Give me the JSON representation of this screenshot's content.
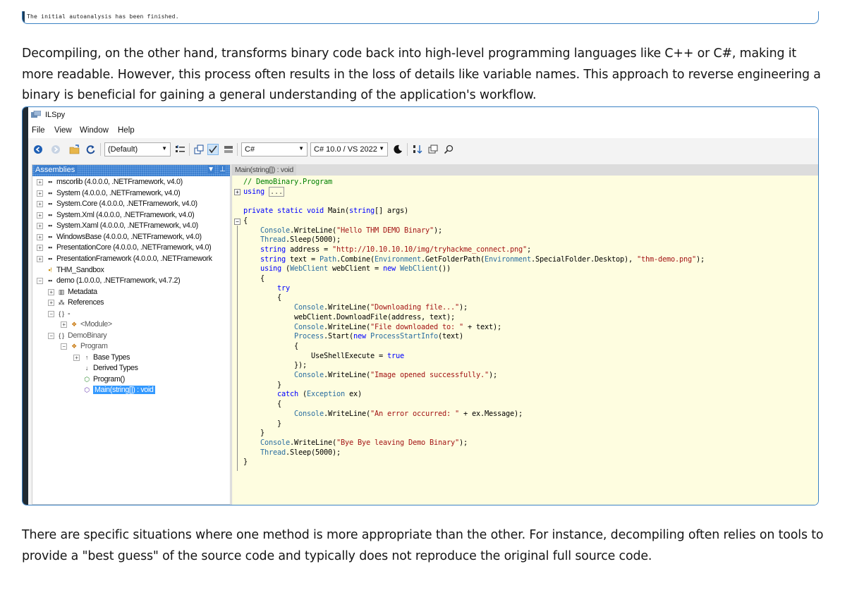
{
  "top_strip": {
    "text": "The initial autoanalysis has been finished."
  },
  "intro": "Decompiling, on the other hand, transforms binary code back into high-level programming languages like C++ or C#, making it more readable. However, this process often results in the loss of details like variable names. This approach to reverse engineering a binary is beneficial for gaining a general understanding of the application's workflow.",
  "outro": "There are specific situations where one method is more appropriate than the other. For instance, decompiling often relies on tools to provide a \"best guess\" of the source code and typically does not reproduce the original full source code.",
  "window": {
    "title": "ILSpy",
    "menu": [
      "File",
      "View",
      "Window",
      "Help"
    ],
    "toolbar": {
      "profile_combo": "(Default)",
      "language_combo": "C#",
      "version_combo": "C# 10.0 / VS 2022"
    }
  },
  "assemblies": {
    "header": "Assemblies",
    "nodes": [
      {
        "label": "mscorlib (4.0.0.0, .NETFramework, v4.0)"
      },
      {
        "label": "System (4.0.0.0, .NETFramework, v4.0)"
      },
      {
        "label": "System.Core (4.0.0.0, .NETFramework, v4.0)"
      },
      {
        "label": "System.Xml (4.0.0.0, .NETFramework, v4.0)"
      },
      {
        "label": "System.Xaml (4.0.0.0, .NETFramework, v4.0)"
      },
      {
        "label": "WindowsBase (4.0.0.0, .NETFramework, v4.0)"
      },
      {
        "label": "PresentationCore (4.0.0.0, .NETFramework, v4.0)"
      },
      {
        "label": "PresentationFramework (4.0.0.0, .NETFramework"
      },
      {
        "label": "THM_Sandbox"
      },
      {
        "label": "demo (1.0.0.0, .NETFramework, v4.7.2)"
      },
      {
        "label": "Metadata"
      },
      {
        "label": "References"
      },
      {
        "label": "-"
      },
      {
        "label": "<Module>"
      },
      {
        "label": "DemoBinary"
      },
      {
        "label": "Program"
      },
      {
        "label": "Base Types"
      },
      {
        "label": "Derived Types"
      },
      {
        "label": "Program()"
      },
      {
        "label": "Main(string[]) : void"
      }
    ]
  },
  "code_tab": "Main(string[]) : void",
  "code_lines": [
    "// DemoBinary.Program",
    "using ...",
    "",
    "private static void Main(string[] args)",
    "{",
    "    Console.WriteLine(\"Hello THM DEMO Binary\");",
    "    Thread.Sleep(5000);",
    "    string address = \"http://10.10.10.10/img/tryhackme_connect.png\";",
    "    string text = Path.Combine(Environment.GetFolderPath(Environment.SpecialFolder.Desktop), \"thm-demo.png\");",
    "    using (WebClient webClient = new WebClient())",
    "    {",
    "        try",
    "        {",
    "            Console.WriteLine(\"Downloading file...\");",
    "            webClient.DownloadFile(address, text);",
    "            Console.WriteLine(\"File downloaded to: \" + text);",
    "            Process.Start(new ProcessStartInfo(text)",
    "            {",
    "                UseShellExecute = true",
    "            });",
    "            Console.WriteLine(\"Image opened successfully.\");",
    "        }",
    "        catch (Exception ex)",
    "        {",
    "            Console.WriteLine(\"An error occurred: \" + ex.Message);",
    "        }",
    "    }",
    "    Console.WriteLine(\"Bye Bye leaving Demo Binary\");",
    "    Thread.Sleep(5000);",
    "}"
  ]
}
